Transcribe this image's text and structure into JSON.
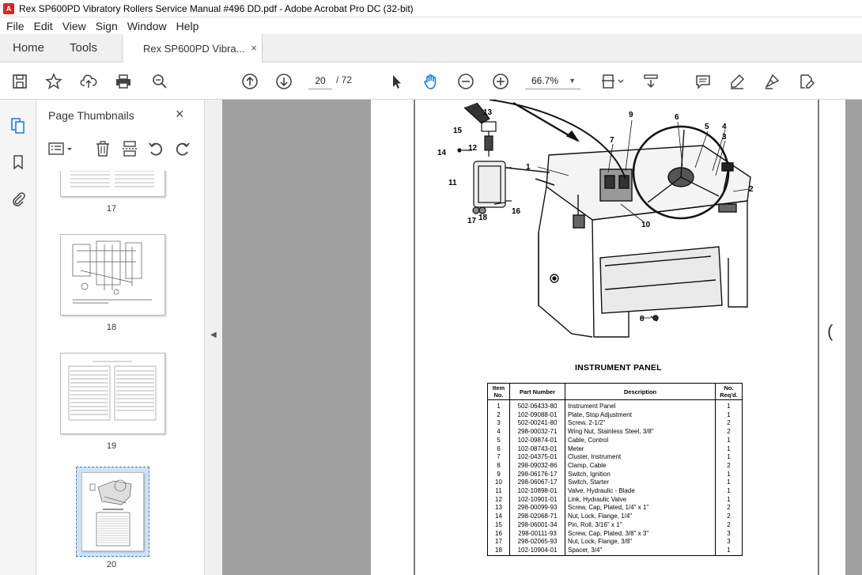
{
  "window": {
    "title": "Rex SP600PD Vibratory Rollers Service Manual #496 DD.pdf - Adobe Acrobat Pro DC (32-bit)",
    "app_icon_label": "A"
  },
  "menu": [
    "File",
    "Edit",
    "View",
    "Sign",
    "Window",
    "Help"
  ],
  "tabs": {
    "home": "Home",
    "tools": "Tools",
    "document": "Rex SP600PD Vibra...",
    "close": "×"
  },
  "toolbar": {
    "current_page": "20",
    "total_pages": "/ 72",
    "zoom": "66.7%"
  },
  "thumbnails": {
    "title": "Page Thumbnails",
    "close": "×",
    "pages": [
      "17",
      "18",
      "19",
      "20"
    ],
    "selected": "20"
  },
  "document": {
    "figure_title": "INSTRUMENT PANEL",
    "callouts": [
      "1",
      "2",
      "3",
      "4",
      "5",
      "6",
      "7",
      "8",
      "9",
      "10",
      "11",
      "12",
      "13",
      "14",
      "15",
      "16",
      "17",
      "18"
    ],
    "table": {
      "headers": {
        "item": "Item No.",
        "part": "Part Number",
        "description": "Description",
        "qty": "No. Req'd."
      },
      "rows": [
        {
          "item": "1",
          "part": "502-06433-80",
          "desc": "Instrument Panel",
          "qty": "1"
        },
        {
          "item": "2",
          "part": "102-09088-01",
          "desc": "Plate, Stop Adjustment",
          "qty": "1"
        },
        {
          "item": "3",
          "part": "502-00241-80",
          "desc": "Screw, 2-1/2\"",
          "qty": "2"
        },
        {
          "item": "4",
          "part": "298-00032-71",
          "desc": "Wing Nut, Stainless Steel, 3/8\"",
          "qty": "2"
        },
        {
          "item": "5",
          "part": "102-09874-01",
          "desc": "Cable, Control",
          "qty": "1"
        },
        {
          "item": "6",
          "part": "102-08743-01",
          "desc": "Meter",
          "qty": "1"
        },
        {
          "item": "7",
          "part": "102-04375-01",
          "desc": "Cluster, Instrument",
          "qty": "1"
        },
        {
          "item": "8",
          "part": "298-09032-86",
          "desc": "Clamp, Cable",
          "qty": "2"
        },
        {
          "item": "9",
          "part": "298-06176-17",
          "desc": "Switch, Ignition",
          "qty": "1"
        },
        {
          "item": "10",
          "part": "298-06067-17",
          "desc": "Switch, Starter",
          "qty": "1"
        },
        {
          "item": "11",
          "part": "102-10898-01",
          "desc": "Valve, Hydraulic - Blade",
          "qty": "1"
        },
        {
          "item": "12",
          "part": "102-10901-01",
          "desc": "Link, Hydraulic Valve",
          "qty": "1"
        },
        {
          "item": "13",
          "part": "298-00099-93",
          "desc": "Screw, Cap, Plated, 1/4\" x 1\"",
          "qty": "2"
        },
        {
          "item": "14",
          "part": "298-02068-71",
          "desc": "Nut, Lock, Flange, 1/4\"",
          "qty": "2"
        },
        {
          "item": "15",
          "part": "298-06001-34",
          "desc": "Pin, Roll, 3/16\" x 1\"",
          "qty": "2"
        },
        {
          "item": "16",
          "part": "298-00111-93",
          "desc": "Screw, Cap, Plated, 3/8\" x 3\"",
          "qty": "3"
        },
        {
          "item": "17",
          "part": "298-02065-93",
          "desc": "Nut, Lock, Flange, 3/8\"",
          "qty": "3"
        },
        {
          "item": "18",
          "part": "102-10904-01",
          "desc": "Spacer, 3/4\"",
          "qty": "1"
        }
      ]
    }
  }
}
